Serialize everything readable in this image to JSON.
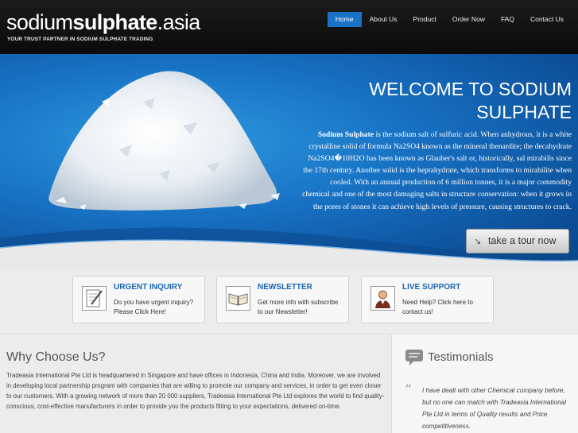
{
  "header": {
    "logo_light": "sodium",
    "logo_bold": "sulphate",
    "logo_suffix": ".asia",
    "tagline": "YOUR TRUST PARTNER IN SODIUM SULPHATE TRADING",
    "nav": [
      {
        "label": "Home",
        "active": true
      },
      {
        "label": "About Us",
        "active": false
      },
      {
        "label": "Product",
        "active": false
      },
      {
        "label": "Order Now",
        "active": false
      },
      {
        "label": "FAQ",
        "active": false
      },
      {
        "label": "Contact Us",
        "active": false
      }
    ]
  },
  "hero": {
    "title_line1_a": "WELCOME TO ",
    "title_line1_b": "SODIUM",
    "title_line2": "SULPHATE",
    "text_bold": "Sodium Sulphate",
    "text_body": " is the sodium salt of sulfuric acid. When anhydrous, it is a white crystalline solid of formula Na2SO4 known as the mineral thenardite; the decahydrate Na2SO4�10H2O has been known as Glauber's salt or, historically, sal mirabilis since the 17th century. Another solid is the heptahydrate, which transforms to mirabilite when cooled. With an annual production of 6 million tonnes, it is a major commodity chemical and one of the most damaging salts in structure conservation: when it grows in the pores of stones it can achieve high levels of pressure, causing structures to crack.",
    "tour_button": "take a tour now"
  },
  "boxes": [
    {
      "title": "URGENT INQUIRY",
      "desc": "Do you have urgent inquiry? Please Click Here!",
      "icon": "pen-paper-icon"
    },
    {
      "title": "NEWSLETTER",
      "desc": "Get more info with subscribe to our Newsletter!",
      "icon": "open-book-icon"
    },
    {
      "title": "LIVE SUPPORT",
      "desc": "Need Help? Click here to contact us!",
      "icon": "support-person-icon"
    }
  ],
  "why": {
    "heading": "Why Choose Us?",
    "text": "Tradeasia International Pte Ltd is headquartered in Singapore and have offices in Indonesia, China and India. Moreover, we are involved in developing local partnership program with companies that are willing to promote our company and services, in order to get even closer to our customers. With a growing network of more than 20 000 suppliers, Tradeasia International Pte Ltd explores the world to find quality-conscious, cost-effective manufacturers in order to provide you the products fitting to your expectations, delivered on-time."
  },
  "testimonials": {
    "heading": "Testimonials",
    "quote": "I have dealt with other Chemical company before, but no one can match with Tradeasia International Pte Ltd in terms of Quality results and Price competitiveness."
  },
  "colors": {
    "nav_active": "#1b73c8",
    "hero_blue": "#1872c4",
    "box_title": "#1a66b5"
  }
}
